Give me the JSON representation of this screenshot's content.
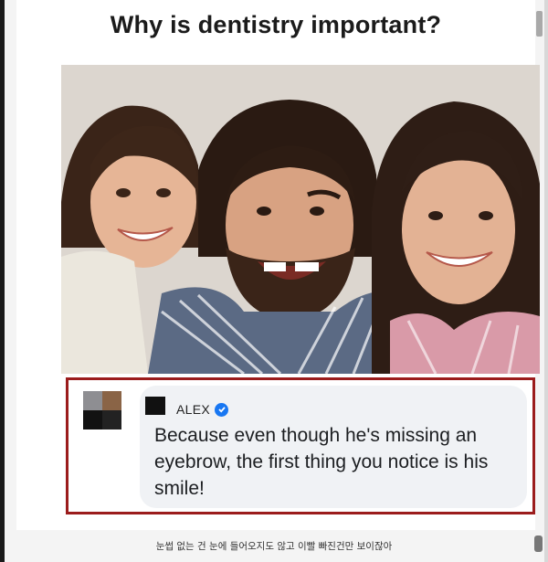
{
  "meme": {
    "title": "Why is dentistry important?"
  },
  "comment": {
    "user_name": "ALEX",
    "text": "Because even though he's missing an eyebrow, the first thing you notice is his smile!"
  },
  "caption": "눈썹 없는 건 눈에 들어오지도 않고 이빨 빠진건만 보이잖아",
  "colors": {
    "highlight_border": "#9b1c1c",
    "verified_badge": "#1877f2",
    "bubble_bg": "#f0f2f5"
  },
  "icons": [
    "verified-badge-icon"
  ]
}
